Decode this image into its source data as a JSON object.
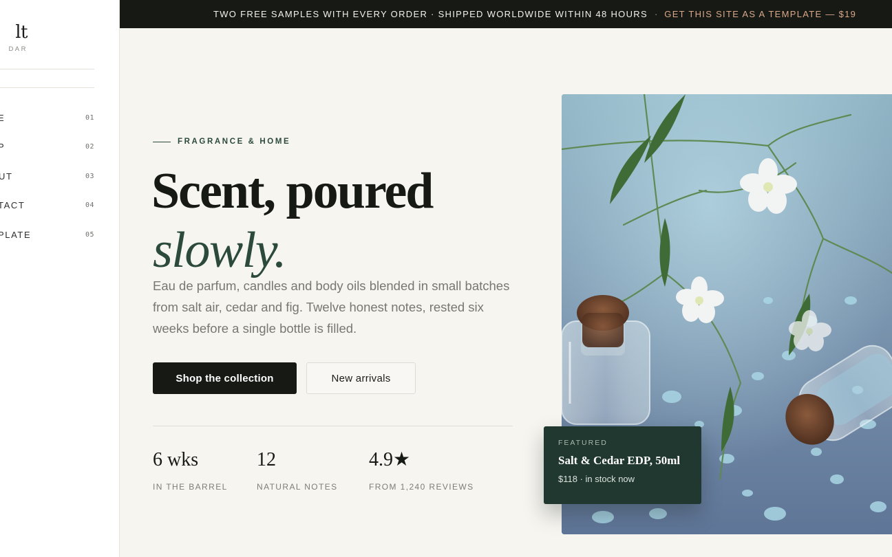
{
  "brand": {
    "name": "lt",
    "sub": "DAR"
  },
  "nav": [
    {
      "label": "E",
      "num": "01"
    },
    {
      "label": "P",
      "num": "02"
    },
    {
      "label": "UT",
      "num": "03"
    },
    {
      "label": "TACT",
      "num": "04"
    },
    {
      "label": "PLATE",
      "num": "05"
    }
  ],
  "topbar": {
    "message": "TWO FREE SAMPLES WITH EVERY ORDER · SHIPPED WORLDWIDE WITHIN 48 HOURS",
    "separator": "·",
    "link": "GET THIS SITE AS A TEMPLATE — $19"
  },
  "hero": {
    "eyebrow": "FRAGRANCE & HOME",
    "headline": "Scent, poured",
    "headline_em": "slowly.",
    "lede": "Eau de parfum, candles and body oils blended in small batches from salt air, cedar and fig. Twelve honest notes, rested six weeks before a single bottle is filled.",
    "primary_cta": "Shop the collection",
    "secondary_cta": "New arrivals"
  },
  "stats": [
    {
      "value": "6 wks",
      "label": "IN THE BARREL"
    },
    {
      "value": "12",
      "label": "NATURAL NOTES"
    },
    {
      "value": "4.9★",
      "label": "FROM 1,240 REVIEWS"
    }
  ],
  "featured": {
    "eyebrow": "FEATURED",
    "title": "Salt & Cedar EDP, 50ml",
    "meta": "$118 · in stock now"
  },
  "colors": {
    "accent_green": "#2c4a3c",
    "dark": "#171915",
    "link_peach": "#d9a88a",
    "background": "#f6f5f0"
  }
}
